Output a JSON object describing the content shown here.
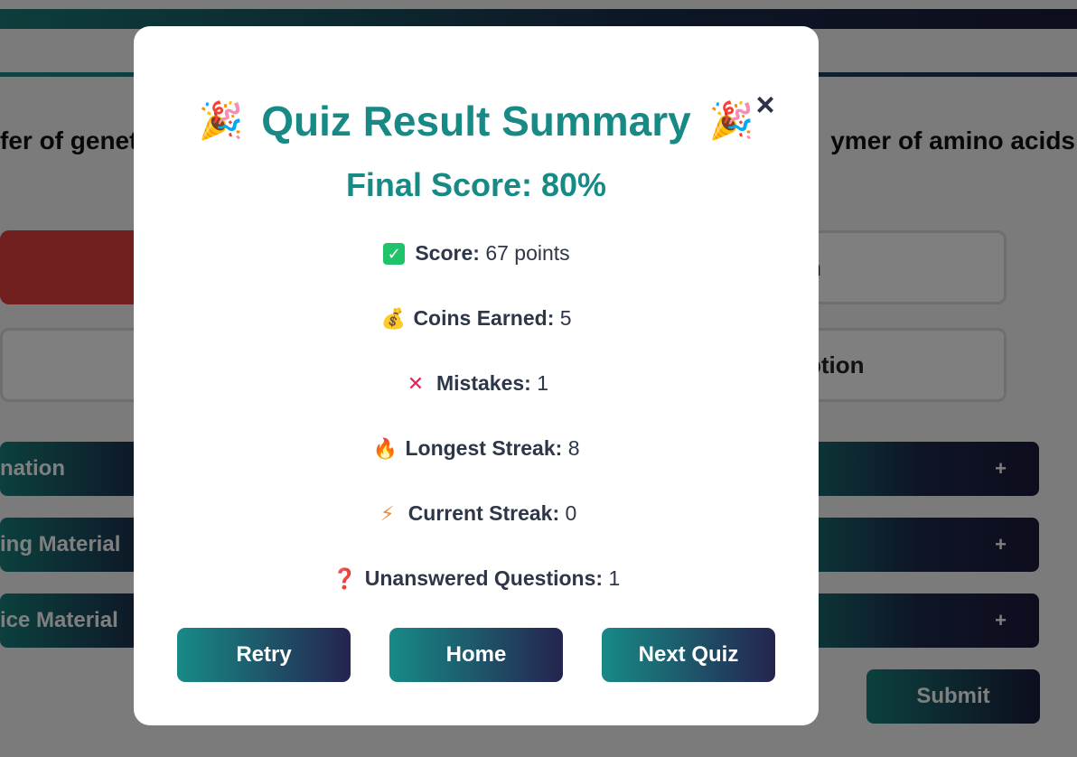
{
  "background": {
    "question_left": "fer of genet",
    "question_right": "ymer of amino acids",
    "option_right_1": "n",
    "option_right_2": "ption",
    "accordion": [
      {
        "label": "nation",
        "toggle": "+"
      },
      {
        "label": "ing Material",
        "toggle": "+"
      },
      {
        "label": "ice Material",
        "toggle": "+"
      }
    ],
    "submit_label": "Submit"
  },
  "modal": {
    "title": "Quiz Result Summary",
    "title_emoji_left": "🎉",
    "title_emoji_right": "🎉",
    "close_label": "×",
    "final_score": "Final Score: 80%",
    "stats": [
      {
        "icon": "check-icon",
        "glyph": "✓",
        "label": "Score:",
        "value": "67 points"
      },
      {
        "icon": "money-bag-icon",
        "glyph": "💰",
        "label": "Coins Earned:",
        "value": "5"
      },
      {
        "icon": "cross-icon",
        "glyph": "✕",
        "label": "Mistakes:",
        "value": "1"
      },
      {
        "icon": "fire-icon",
        "glyph": "🔥",
        "label": "Longest Streak:",
        "value": "8"
      },
      {
        "icon": "lightning-icon",
        "glyph": "⚡",
        "label": "Current Streak:",
        "value": "0"
      },
      {
        "icon": "question-icon",
        "glyph": "❓",
        "label": "Unanswered Questions:",
        "value": "1"
      }
    ],
    "buttons": {
      "retry": "Retry",
      "home": "Home",
      "next": "Next Quiz"
    }
  }
}
